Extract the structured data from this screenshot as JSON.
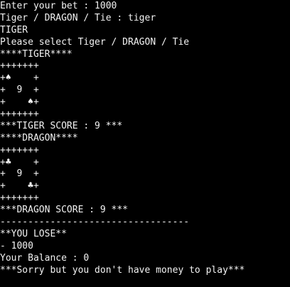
{
  "console": {
    "lines": [
      "Enter your bet : 1000",
      "Tiger / DRAGON / Tie : tiger",
      "TIGER",
      "Please select Tiger / DRAGON / Tie",
      "****TIGER****",
      "+++++++",
      "+♠    +",
      "+  9  +",
      "+    ♠+",
      "+++++++",
      "***TIGER SCORE : 9 ***",
      "****DRAGON****",
      "+++++++",
      "+♣    +",
      "+  9  +",
      "+    ♣+",
      "+++++++",
      "***DRAGON SCORE : 9 ***",
      "----------------------------------",
      "**YOU LOSE**",
      "- 1000",
      "Your Balance : 0",
      "***Sorry but you don't have money to play***"
    ]
  },
  "colors": {
    "background": "#000000",
    "text": "#f2f2f2"
  }
}
